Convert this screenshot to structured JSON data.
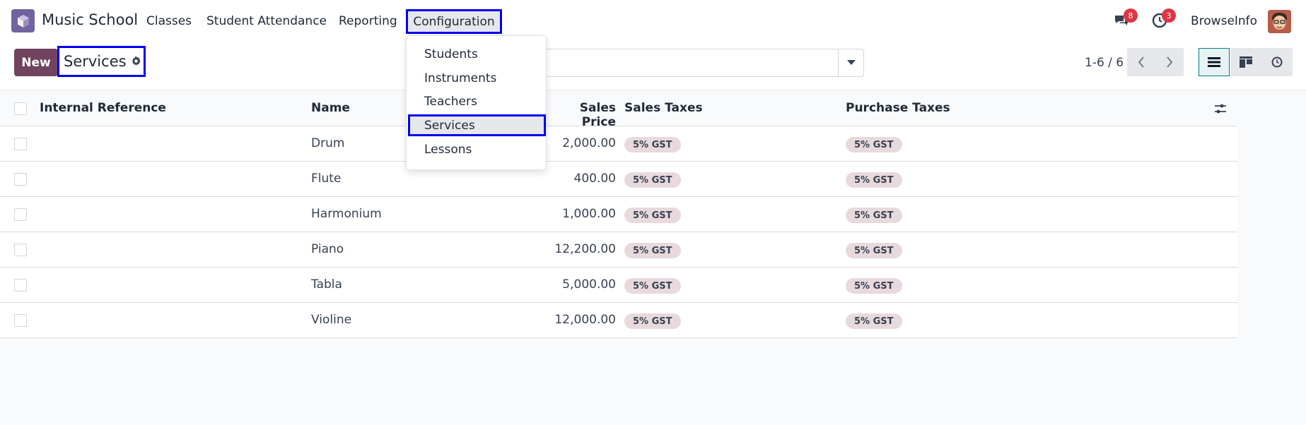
{
  "navbar": {
    "app_name": "Music School",
    "menu": [
      "Classes",
      "Student Attendance",
      "Reporting",
      "Configuration"
    ],
    "messages_count": "8",
    "activities_count": "3",
    "user_name": "BrowseInfo"
  },
  "control": {
    "new_label": "New",
    "breadcrumb": "Services",
    "pager": "1-6 / 6"
  },
  "table": {
    "headers": [
      "Internal Reference",
      "Name",
      "Sales Price",
      "Sales Taxes",
      "Purchase Taxes"
    ],
    "rows": [
      {
        "ref": "",
        "name": "Drum",
        "price": "2,000.00",
        "sales_tax": "5% GST",
        "purchase_tax": "5% GST"
      },
      {
        "ref": "",
        "name": "Flute",
        "price": "400.00",
        "sales_tax": "5% GST",
        "purchase_tax": "5% GST"
      },
      {
        "ref": "",
        "name": "Harmonium",
        "price": "1,000.00",
        "sales_tax": "5% GST",
        "purchase_tax": "5% GST"
      },
      {
        "ref": "",
        "name": "Piano",
        "price": "12,200.00",
        "sales_tax": "5% GST",
        "purchase_tax": "5% GST"
      },
      {
        "ref": "",
        "name": "Tabla",
        "price": "5,000.00",
        "sales_tax": "5% GST",
        "purchase_tax": "5% GST"
      },
      {
        "ref": "",
        "name": "Violine",
        "price": "12,000.00",
        "sales_tax": "5% GST",
        "purchase_tax": "5% GST"
      }
    ]
  },
  "dropdown": {
    "items": [
      "Students",
      "Instruments",
      "Teachers",
      "Services",
      "Lessons"
    ],
    "selected": "Services"
  },
  "colors": {
    "brand": "#71639e",
    "new_button": "#71435f",
    "highlight_border": "#0000ee",
    "badge": "#dc3545",
    "tag": "#e8d9dd"
  }
}
